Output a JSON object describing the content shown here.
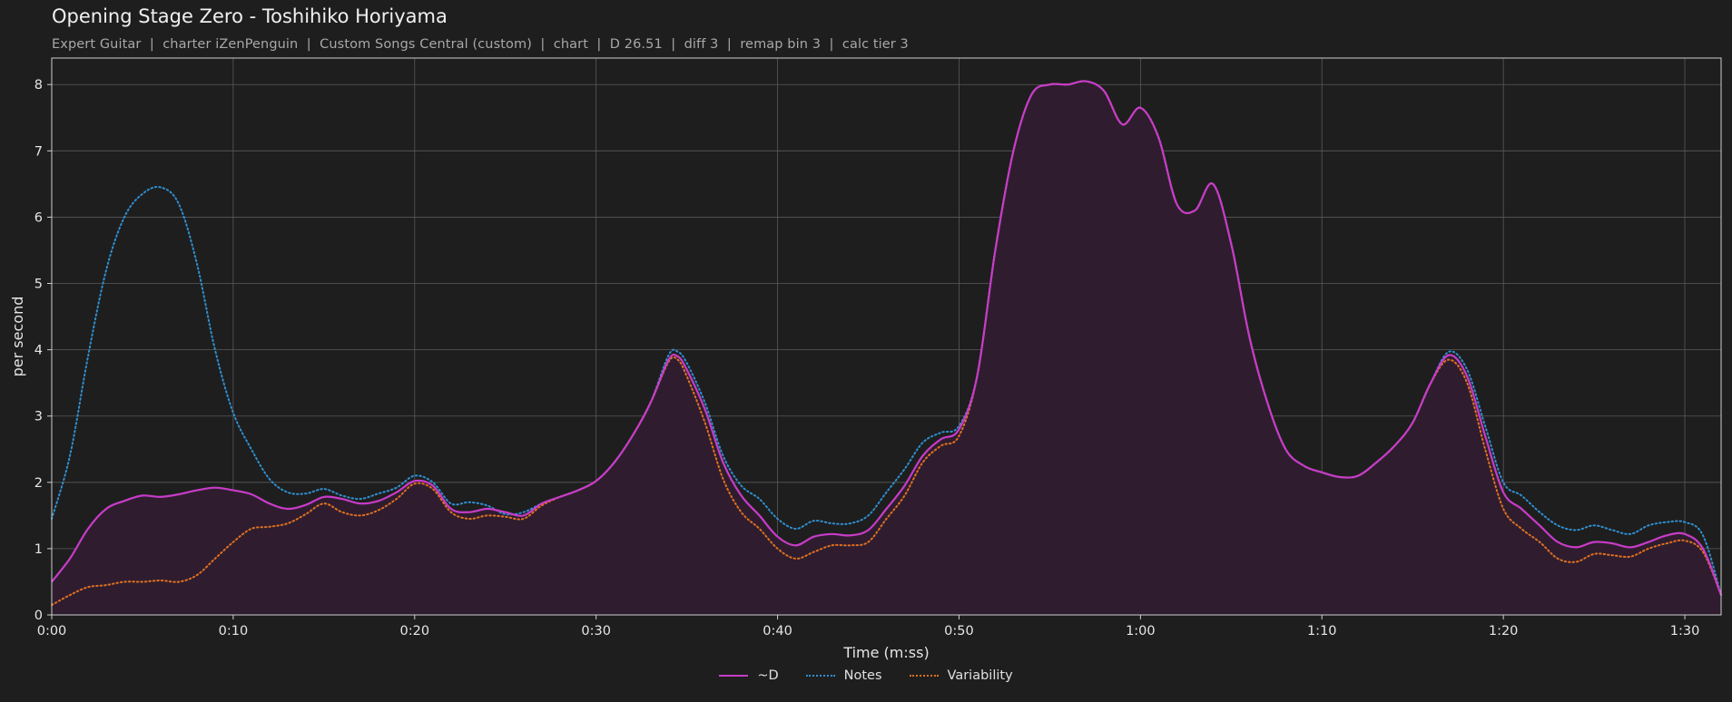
{
  "header": {
    "title": "Opening Stage Zero - Toshihiko Horiyama",
    "subtitle": "Expert Guitar  |  charter iZenPenguin  |  Custom Songs Central (custom)  |  chart  |  D 26.51  |  diff 3  |  remap bin 3  |  calc tier 3"
  },
  "colors": {
    "background": "#1e1e1e",
    "grid": "#5a5a5a",
    "axis": "#cfcfcf",
    "d_line": "#c83cc8",
    "notes_line": "#2f8fd0",
    "variability_line": "#e07020",
    "area_fill": "#2f1d2f"
  },
  "chart_data": {
    "type": "line",
    "xlabel": "Time (m:ss)",
    "ylabel": "per second",
    "xlim": [
      0,
      92
    ],
    "ylim": [
      0,
      8.4
    ],
    "grid": true,
    "legend_position": "bottom-center",
    "x_ticks": [
      {
        "value": 0,
        "label": "0:00"
      },
      {
        "value": 10,
        "label": "0:10"
      },
      {
        "value": 20,
        "label": "0:20"
      },
      {
        "value": 30,
        "label": "0:30"
      },
      {
        "value": 40,
        "label": "0:40"
      },
      {
        "value": 50,
        "label": "0:50"
      },
      {
        "value": 60,
        "label": "1:00"
      },
      {
        "value": 70,
        "label": "1:10"
      },
      {
        "value": 80,
        "label": "1:20"
      },
      {
        "value": 90,
        "label": "1:30"
      }
    ],
    "y_ticks": [
      0,
      1,
      2,
      3,
      4,
      5,
      6,
      7,
      8
    ],
    "series": [
      {
        "name": "~D",
        "style": "solid",
        "color": "#c83cc8",
        "filled": true,
        "points": [
          [
            0,
            0.5
          ],
          [
            1,
            0.85
          ],
          [
            2,
            1.3
          ],
          [
            3,
            1.6
          ],
          [
            4,
            1.72
          ],
          [
            5,
            1.8
          ],
          [
            6,
            1.78
          ],
          [
            7,
            1.82
          ],
          [
            8,
            1.88
          ],
          [
            9,
            1.92
          ],
          [
            10,
            1.88
          ],
          [
            11,
            1.82
          ],
          [
            12,
            1.68
          ],
          [
            13,
            1.6
          ],
          [
            14,
            1.66
          ],
          [
            15,
            1.78
          ],
          [
            16,
            1.75
          ],
          [
            17,
            1.68
          ],
          [
            18,
            1.72
          ],
          [
            19,
            1.85
          ],
          [
            20,
            2.02
          ],
          [
            21,
            1.95
          ],
          [
            22,
            1.6
          ],
          [
            23,
            1.55
          ],
          [
            24,
            1.6
          ],
          [
            25,
            1.55
          ],
          [
            26,
            1.5
          ],
          [
            27,
            1.68
          ],
          [
            28,
            1.78
          ],
          [
            29,
            1.88
          ],
          [
            30,
            2.02
          ],
          [
            31,
            2.3
          ],
          [
            32,
            2.7
          ],
          [
            33,
            3.2
          ],
          [
            34,
            3.85
          ],
          [
            34.5,
            3.9
          ],
          [
            35,
            3.7
          ],
          [
            36,
            3.1
          ],
          [
            37,
            2.3
          ],
          [
            38,
            1.8
          ],
          [
            39,
            1.5
          ],
          [
            40,
            1.18
          ],
          [
            41,
            1.05
          ],
          [
            42,
            1.18
          ],
          [
            43,
            1.22
          ],
          [
            44,
            1.2
          ],
          [
            45,
            1.28
          ],
          [
            46,
            1.6
          ],
          [
            47,
            1.95
          ],
          [
            48,
            2.4
          ],
          [
            49,
            2.65
          ],
          [
            50,
            2.8
          ],
          [
            51,
            3.6
          ],
          [
            52,
            5.5
          ],
          [
            53,
            7.0
          ],
          [
            54,
            7.85
          ],
          [
            55,
            8.0
          ],
          [
            56,
            8.0
          ],
          [
            57,
            8.05
          ],
          [
            58,
            7.9
          ],
          [
            59,
            7.4
          ],
          [
            60,
            7.65
          ],
          [
            61,
            7.2
          ],
          [
            62,
            6.2
          ],
          [
            63,
            6.1
          ],
          [
            64,
            6.5
          ],
          [
            65,
            5.6
          ],
          [
            66,
            4.2
          ],
          [
            67,
            3.2
          ],
          [
            68,
            2.5
          ],
          [
            69,
            2.25
          ],
          [
            70,
            2.15
          ],
          [
            71,
            2.08
          ],
          [
            72,
            2.1
          ],
          [
            73,
            2.3
          ],
          [
            74,
            2.55
          ],
          [
            75,
            2.9
          ],
          [
            76,
            3.5
          ],
          [
            77,
            3.92
          ],
          [
            78,
            3.6
          ],
          [
            79,
            2.7
          ],
          [
            80,
            1.85
          ],
          [
            81,
            1.6
          ],
          [
            82,
            1.35
          ],
          [
            83,
            1.1
          ],
          [
            84,
            1.02
          ],
          [
            85,
            1.1
          ],
          [
            86,
            1.08
          ],
          [
            87,
            1.02
          ],
          [
            88,
            1.1
          ],
          [
            89,
            1.2
          ],
          [
            90,
            1.22
          ],
          [
            91,
            1.0
          ],
          [
            92,
            0.3
          ]
        ]
      },
      {
        "name": "Notes",
        "style": "dotted",
        "color": "#2f8fd0",
        "filled": false,
        "points": [
          [
            0,
            1.45
          ],
          [
            1,
            2.4
          ],
          [
            2,
            3.9
          ],
          [
            3,
            5.2
          ],
          [
            4,
            6.0
          ],
          [
            5,
            6.35
          ],
          [
            6,
            6.45
          ],
          [
            7,
            6.2
          ],
          [
            8,
            5.3
          ],
          [
            9,
            4.0
          ],
          [
            10,
            3.05
          ],
          [
            11,
            2.5
          ],
          [
            12,
            2.05
          ],
          [
            13,
            1.85
          ],
          [
            14,
            1.83
          ],
          [
            15,
            1.9
          ],
          [
            16,
            1.8
          ],
          [
            17,
            1.75
          ],
          [
            18,
            1.83
          ],
          [
            19,
            1.92
          ],
          [
            20,
            2.1
          ],
          [
            21,
            2.0
          ],
          [
            22,
            1.68
          ],
          [
            23,
            1.7
          ],
          [
            24,
            1.65
          ],
          [
            25,
            1.52
          ],
          [
            26,
            1.55
          ],
          [
            27,
            1.68
          ],
          [
            28,
            1.78
          ],
          [
            29,
            1.88
          ],
          [
            30,
            2.02
          ],
          [
            31,
            2.3
          ],
          [
            32,
            2.7
          ],
          [
            33,
            3.2
          ],
          [
            34,
            3.92
          ],
          [
            34.5,
            3.97
          ],
          [
            35,
            3.8
          ],
          [
            36,
            3.2
          ],
          [
            37,
            2.4
          ],
          [
            38,
            1.95
          ],
          [
            39,
            1.75
          ],
          [
            40,
            1.45
          ],
          [
            41,
            1.3
          ],
          [
            42,
            1.42
          ],
          [
            43,
            1.38
          ],
          [
            44,
            1.38
          ],
          [
            45,
            1.5
          ],
          [
            46,
            1.85
          ],
          [
            47,
            2.2
          ],
          [
            48,
            2.6
          ],
          [
            49,
            2.75
          ],
          [
            50,
            2.85
          ],
          [
            51,
            3.6
          ],
          [
            52,
            5.5
          ],
          [
            53,
            7.0
          ],
          [
            54,
            7.85
          ],
          [
            55,
            8.0
          ],
          [
            56,
            8.0
          ],
          [
            57,
            8.05
          ],
          [
            58,
            7.9
          ],
          [
            59,
            7.4
          ],
          [
            60,
            7.65
          ],
          [
            61,
            7.2
          ],
          [
            62,
            6.2
          ],
          [
            63,
            6.1
          ],
          [
            64,
            6.5
          ],
          [
            65,
            5.6
          ],
          [
            66,
            4.2
          ],
          [
            67,
            3.2
          ],
          [
            68,
            2.5
          ],
          [
            69,
            2.25
          ],
          [
            70,
            2.15
          ],
          [
            71,
            2.08
          ],
          [
            72,
            2.1
          ],
          [
            73,
            2.3
          ],
          [
            74,
            2.55
          ],
          [
            75,
            2.9
          ],
          [
            76,
            3.5
          ],
          [
            77,
            3.97
          ],
          [
            78,
            3.7
          ],
          [
            79,
            2.85
          ],
          [
            80,
            2.0
          ],
          [
            81,
            1.8
          ],
          [
            82,
            1.55
          ],
          [
            83,
            1.35
          ],
          [
            84,
            1.28
          ],
          [
            85,
            1.35
          ],
          [
            86,
            1.28
          ],
          [
            87,
            1.22
          ],
          [
            88,
            1.35
          ],
          [
            89,
            1.4
          ],
          [
            90,
            1.4
          ],
          [
            91,
            1.2
          ],
          [
            92,
            0.3
          ]
        ]
      },
      {
        "name": "Variability",
        "style": "dotted",
        "color": "#e07020",
        "filled": false,
        "points": [
          [
            0,
            0.15
          ],
          [
            1,
            0.3
          ],
          [
            2,
            0.42
          ],
          [
            3,
            0.45
          ],
          [
            4,
            0.5
          ],
          [
            5,
            0.5
          ],
          [
            6,
            0.52
          ],
          [
            7,
            0.5
          ],
          [
            8,
            0.6
          ],
          [
            9,
            0.85
          ],
          [
            10,
            1.1
          ],
          [
            11,
            1.3
          ],
          [
            12,
            1.33
          ],
          [
            13,
            1.38
          ],
          [
            14,
            1.52
          ],
          [
            15,
            1.68
          ],
          [
            16,
            1.55
          ],
          [
            17,
            1.5
          ],
          [
            18,
            1.58
          ],
          [
            19,
            1.75
          ],
          [
            20,
            1.98
          ],
          [
            21,
            1.9
          ],
          [
            22,
            1.55
          ],
          [
            23,
            1.45
          ],
          [
            24,
            1.5
          ],
          [
            25,
            1.48
          ],
          [
            26,
            1.45
          ],
          [
            27,
            1.65
          ],
          [
            28,
            1.78
          ],
          [
            29,
            1.88
          ],
          [
            30,
            2.02
          ],
          [
            31,
            2.3
          ],
          [
            32,
            2.7
          ],
          [
            33,
            3.2
          ],
          [
            34,
            3.82
          ],
          [
            34.5,
            3.85
          ],
          [
            35,
            3.6
          ],
          [
            36,
            2.9
          ],
          [
            37,
            2.05
          ],
          [
            38,
            1.55
          ],
          [
            39,
            1.3
          ],
          [
            40,
            1.0
          ],
          [
            41,
            0.85
          ],
          [
            42,
            0.95
          ],
          [
            43,
            1.05
          ],
          [
            44,
            1.05
          ],
          [
            45,
            1.1
          ],
          [
            46,
            1.45
          ],
          [
            47,
            1.8
          ],
          [
            48,
            2.3
          ],
          [
            49,
            2.55
          ],
          [
            50,
            2.7
          ],
          [
            51,
            3.6
          ],
          [
            52,
            5.5
          ],
          [
            53,
            7.0
          ],
          [
            54,
            7.85
          ],
          [
            55,
            8.0
          ],
          [
            56,
            8.0
          ],
          [
            57,
            8.05
          ],
          [
            58,
            7.9
          ],
          [
            59,
            7.4
          ],
          [
            60,
            7.65
          ],
          [
            61,
            7.2
          ],
          [
            62,
            6.2
          ],
          [
            63,
            6.1
          ],
          [
            64,
            6.5
          ],
          [
            65,
            5.6
          ],
          [
            66,
            4.2
          ],
          [
            67,
            3.2
          ],
          [
            68,
            2.5
          ],
          [
            69,
            2.25
          ],
          [
            70,
            2.15
          ],
          [
            71,
            2.08
          ],
          [
            72,
            2.1
          ],
          [
            73,
            2.3
          ],
          [
            74,
            2.55
          ],
          [
            75,
            2.9
          ],
          [
            76,
            3.5
          ],
          [
            77,
            3.85
          ],
          [
            78,
            3.5
          ],
          [
            79,
            2.5
          ],
          [
            80,
            1.6
          ],
          [
            81,
            1.3
          ],
          [
            82,
            1.1
          ],
          [
            83,
            0.85
          ],
          [
            84,
            0.8
          ],
          [
            85,
            0.92
          ],
          [
            86,
            0.9
          ],
          [
            87,
            0.88
          ],
          [
            88,
            1.0
          ],
          [
            89,
            1.08
          ],
          [
            90,
            1.12
          ],
          [
            91,
            0.95
          ],
          [
            92,
            0.3
          ]
        ]
      }
    ]
  }
}
